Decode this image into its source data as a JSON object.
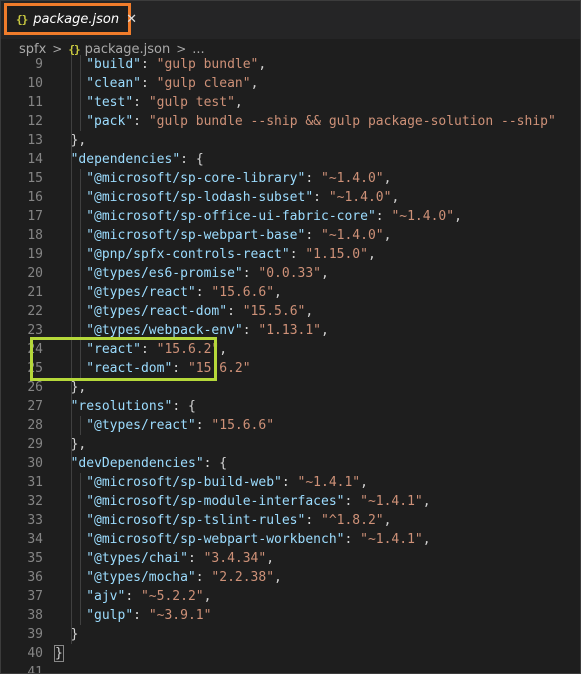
{
  "tab": {
    "icon": "{}",
    "label": "package.json",
    "close": "✕"
  },
  "breadcrumb": {
    "folder": "spfx",
    "sep1": ">",
    "icon": "{}",
    "file": "package.json",
    "sep2": ">",
    "more": "..."
  },
  "lines": [
    {
      "n": "9",
      "indent": 2,
      "tokens": [
        [
          "k",
          "\"build\""
        ],
        [
          "p",
          ": "
        ],
        [
          "s",
          "\"gulp bundle\""
        ],
        [
          "p",
          ","
        ]
      ]
    },
    {
      "n": "10",
      "indent": 2,
      "tokens": [
        [
          "k",
          "\"clean\""
        ],
        [
          "p",
          ": "
        ],
        [
          "s",
          "\"gulp clean\""
        ],
        [
          "p",
          ","
        ]
      ]
    },
    {
      "n": "11",
      "indent": 2,
      "tokens": [
        [
          "k",
          "\"test\""
        ],
        [
          "p",
          ": "
        ],
        [
          "s",
          "\"gulp test\""
        ],
        [
          "p",
          ","
        ]
      ]
    },
    {
      "n": "12",
      "indent": 2,
      "tokens": [
        [
          "k",
          "\"pack\""
        ],
        [
          "p",
          ": "
        ],
        [
          "s",
          "\"gulp bundle --ship && gulp package-solution --ship\""
        ]
      ]
    },
    {
      "n": "13",
      "indent": 1,
      "tokens": [
        [
          "p",
          "},"
        ]
      ]
    },
    {
      "n": "14",
      "indent": 1,
      "tokens": [
        [
          "k",
          "\"dependencies\""
        ],
        [
          "p",
          ": {"
        ]
      ]
    },
    {
      "n": "15",
      "indent": 2,
      "tokens": [
        [
          "k",
          "\"@microsoft/sp-core-library\""
        ],
        [
          "p",
          ": "
        ],
        [
          "s",
          "\"~1.4.0\""
        ],
        [
          "p",
          ","
        ]
      ]
    },
    {
      "n": "16",
      "indent": 2,
      "tokens": [
        [
          "k",
          "\"@microsoft/sp-lodash-subset\""
        ],
        [
          "p",
          ": "
        ],
        [
          "s",
          "\"~1.4.0\""
        ],
        [
          "p",
          ","
        ]
      ]
    },
    {
      "n": "17",
      "indent": 2,
      "tokens": [
        [
          "k",
          "\"@microsoft/sp-office-ui-fabric-core\""
        ],
        [
          "p",
          ": "
        ],
        [
          "s",
          "\"~1.4.0\""
        ],
        [
          "p",
          ","
        ]
      ]
    },
    {
      "n": "18",
      "indent": 2,
      "tokens": [
        [
          "k",
          "\"@microsoft/sp-webpart-base\""
        ],
        [
          "p",
          ": "
        ],
        [
          "s",
          "\"~1.4.0\""
        ],
        [
          "p",
          ","
        ]
      ]
    },
    {
      "n": "19",
      "indent": 2,
      "tokens": [
        [
          "k",
          "\"@pnp/spfx-controls-react\""
        ],
        [
          "p",
          ": "
        ],
        [
          "s",
          "\"1.15.0\""
        ],
        [
          "p",
          ","
        ]
      ]
    },
    {
      "n": "20",
      "indent": 2,
      "tokens": [
        [
          "k",
          "\"@types/es6-promise\""
        ],
        [
          "p",
          ": "
        ],
        [
          "s",
          "\"0.0.33\""
        ],
        [
          "p",
          ","
        ]
      ]
    },
    {
      "n": "21",
      "indent": 2,
      "tokens": [
        [
          "k",
          "\"@types/react\""
        ],
        [
          "p",
          ": "
        ],
        [
          "s",
          "\"15.6.6\""
        ],
        [
          "p",
          ","
        ]
      ]
    },
    {
      "n": "22",
      "indent": 2,
      "tokens": [
        [
          "k",
          "\"@types/react-dom\""
        ],
        [
          "p",
          ": "
        ],
        [
          "s",
          "\"15.5.6\""
        ],
        [
          "p",
          ","
        ]
      ]
    },
    {
      "n": "23",
      "indent": 2,
      "tokens": [
        [
          "k",
          "\"@types/webpack-env\""
        ],
        [
          "p",
          ": "
        ],
        [
          "s",
          "\"1.13.1\""
        ],
        [
          "p",
          ","
        ]
      ]
    },
    {
      "n": "24",
      "indent": 2,
      "tokens": [
        [
          "k",
          "\"react\""
        ],
        [
          "p",
          ": "
        ],
        [
          "s",
          "\"15.6.2\""
        ],
        [
          "p",
          ","
        ]
      ]
    },
    {
      "n": "25",
      "indent": 2,
      "tokens": [
        [
          "k",
          "\"react-dom\""
        ],
        [
          "p",
          ": "
        ],
        [
          "s",
          "\"15.6.2\""
        ]
      ]
    },
    {
      "n": "26",
      "indent": 1,
      "tokens": [
        [
          "p",
          "},"
        ]
      ]
    },
    {
      "n": "27",
      "indent": 1,
      "tokens": [
        [
          "k",
          "\"resolutions\""
        ],
        [
          "p",
          ": {"
        ]
      ]
    },
    {
      "n": "28",
      "indent": 2,
      "tokens": [
        [
          "k",
          "\"@types/react\""
        ],
        [
          "p",
          ": "
        ],
        [
          "s",
          "\"15.6.6\""
        ]
      ]
    },
    {
      "n": "29",
      "indent": 1,
      "tokens": [
        [
          "p",
          "},"
        ]
      ]
    },
    {
      "n": "30",
      "indent": 1,
      "tokens": [
        [
          "k",
          "\"devDependencies\""
        ],
        [
          "p",
          ": {"
        ]
      ]
    },
    {
      "n": "31",
      "indent": 2,
      "tokens": [
        [
          "k",
          "\"@microsoft/sp-build-web\""
        ],
        [
          "p",
          ": "
        ],
        [
          "s",
          "\"~1.4.1\""
        ],
        [
          "p",
          ","
        ]
      ]
    },
    {
      "n": "32",
      "indent": 2,
      "tokens": [
        [
          "k",
          "\"@microsoft/sp-module-interfaces\""
        ],
        [
          "p",
          ": "
        ],
        [
          "s",
          "\"~1.4.1\""
        ],
        [
          "p",
          ","
        ]
      ]
    },
    {
      "n": "33",
      "indent": 2,
      "tokens": [
        [
          "k",
          "\"@microsoft/sp-tslint-rules\""
        ],
        [
          "p",
          ": "
        ],
        [
          "s",
          "\"^1.8.2\""
        ],
        [
          "p",
          ","
        ]
      ]
    },
    {
      "n": "34",
      "indent": 2,
      "tokens": [
        [
          "k",
          "\"@microsoft/sp-webpart-workbench\""
        ],
        [
          "p",
          ": "
        ],
        [
          "s",
          "\"~1.4.1\""
        ],
        [
          "p",
          ","
        ]
      ]
    },
    {
      "n": "35",
      "indent": 2,
      "tokens": [
        [
          "k",
          "\"@types/chai\""
        ],
        [
          "p",
          ": "
        ],
        [
          "s",
          "\"3.4.34\""
        ],
        [
          "p",
          ","
        ]
      ]
    },
    {
      "n": "36",
      "indent": 2,
      "tokens": [
        [
          "k",
          "\"@types/mocha\""
        ],
        [
          "p",
          ": "
        ],
        [
          "s",
          "\"2.2.38\""
        ],
        [
          "p",
          ","
        ]
      ]
    },
    {
      "n": "37",
      "indent": 2,
      "tokens": [
        [
          "k",
          "\"ajv\""
        ],
        [
          "p",
          ": "
        ],
        [
          "s",
          "\"~5.2.2\""
        ],
        [
          "p",
          ","
        ]
      ]
    },
    {
      "n": "38",
      "indent": 2,
      "tokens": [
        [
          "k",
          "\"gulp\""
        ],
        [
          "p",
          ": "
        ],
        [
          "s",
          "\"~3.9.1\""
        ]
      ]
    },
    {
      "n": "39",
      "indent": 1,
      "tokens": [
        [
          "p",
          "}"
        ]
      ]
    },
    {
      "n": "40",
      "indent": 0,
      "tokens": [
        [
          "p",
          "}"
        ]
      ]
    },
    {
      "n": "41",
      "indent": 0,
      "tokens": []
    }
  ],
  "colors": {
    "background": "#1e1e1e",
    "tab_highlight": "#f07c2b",
    "code_highlight": "#b5d83a",
    "key": "#9cdcfe",
    "string": "#ce9178",
    "line_number": "#858585"
  }
}
